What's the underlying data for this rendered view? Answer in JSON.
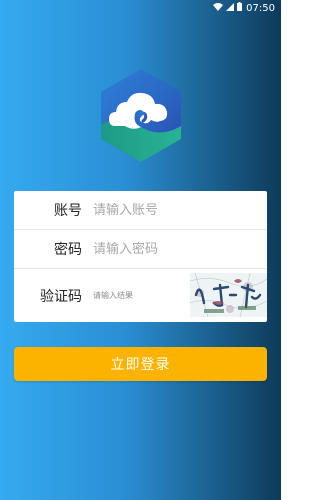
{
  "status_bar": {
    "time": "07:50",
    "icons": [
      "wifi-icon",
      "signal-icon",
      "battery-icon"
    ]
  },
  "app_logo": {
    "icon": "cloud-hexagon-logo"
  },
  "form": {
    "account": {
      "label": "账号",
      "placeholder": "请输入账号",
      "value": ""
    },
    "password": {
      "label": "密码",
      "placeholder": "请输入密码",
      "value": ""
    },
    "captcha": {
      "label": "验证码",
      "placeholder": "请输入结果",
      "value": "",
      "image": "captcha-image"
    }
  },
  "login_button": {
    "label": "立即登录"
  },
  "colors": {
    "button": "#fbb300",
    "gradient_start": "#35aaf0",
    "gradient_end": "#0d3a5a"
  }
}
